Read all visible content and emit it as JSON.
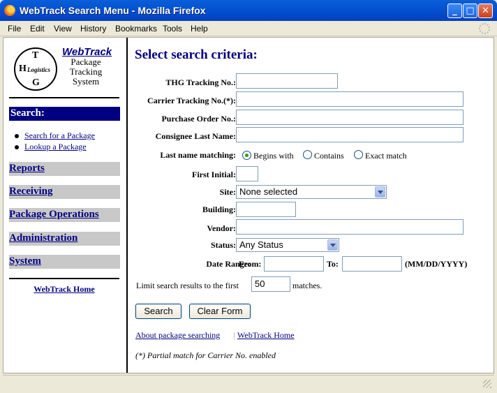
{
  "window": {
    "title": "WebTrack Search Menu - Mozilla Firefox",
    "menu": [
      "File",
      "Edit",
      "View",
      "History",
      "Bookmarks",
      "Tools",
      "Help"
    ]
  },
  "sidebar": {
    "logo": {
      "t": "T",
      "h": "H",
      "logistics": "Logistics",
      "g": "G"
    },
    "brand_link": "WebTrack",
    "subtitle": [
      "Package",
      "Tracking",
      "System"
    ],
    "search_header": "Search:",
    "search_links": [
      "Search for a Package",
      "Lookup a Package"
    ],
    "nav": [
      "Reports",
      "Receiving",
      "Package Operations",
      "Administration",
      "System"
    ],
    "home_link": "WebTrack Home"
  },
  "form": {
    "heading": "Select search criteria:",
    "labels": {
      "thg": "THG Tracking No.:",
      "carrier": "Carrier Tracking No.(*):",
      "po": "Purchase Order No.:",
      "consignee": "Consignee Last Name:",
      "matching": "Last name matching:",
      "initial": "First Initial:",
      "site": "Site:",
      "building": "Building:",
      "vendor": "Vendor:",
      "status": "Status:",
      "date_range": "Date Range:",
      "from": "From:",
      "to": "To:",
      "date_format": "(MM/DD/YYYY)"
    },
    "values": {
      "thg": "",
      "carrier": "",
      "po": "",
      "consignee": "",
      "initial": "",
      "building": "",
      "vendor": "",
      "from": "",
      "to": ""
    },
    "matching_options": [
      "Begins with",
      "Contains",
      "Exact match"
    ],
    "matching_selected": "Begins with",
    "site_selected": "None selected",
    "status_selected": "Any Status",
    "limit": {
      "before": "Limit search results to the first",
      "value": "50",
      "after": "matches."
    },
    "buttons": {
      "search": "Search",
      "clear": "Clear Form"
    },
    "footer_links": [
      "About package searching",
      "WebTrack Home"
    ],
    "note": "(*) Partial match for Carrier No. enabled"
  }
}
